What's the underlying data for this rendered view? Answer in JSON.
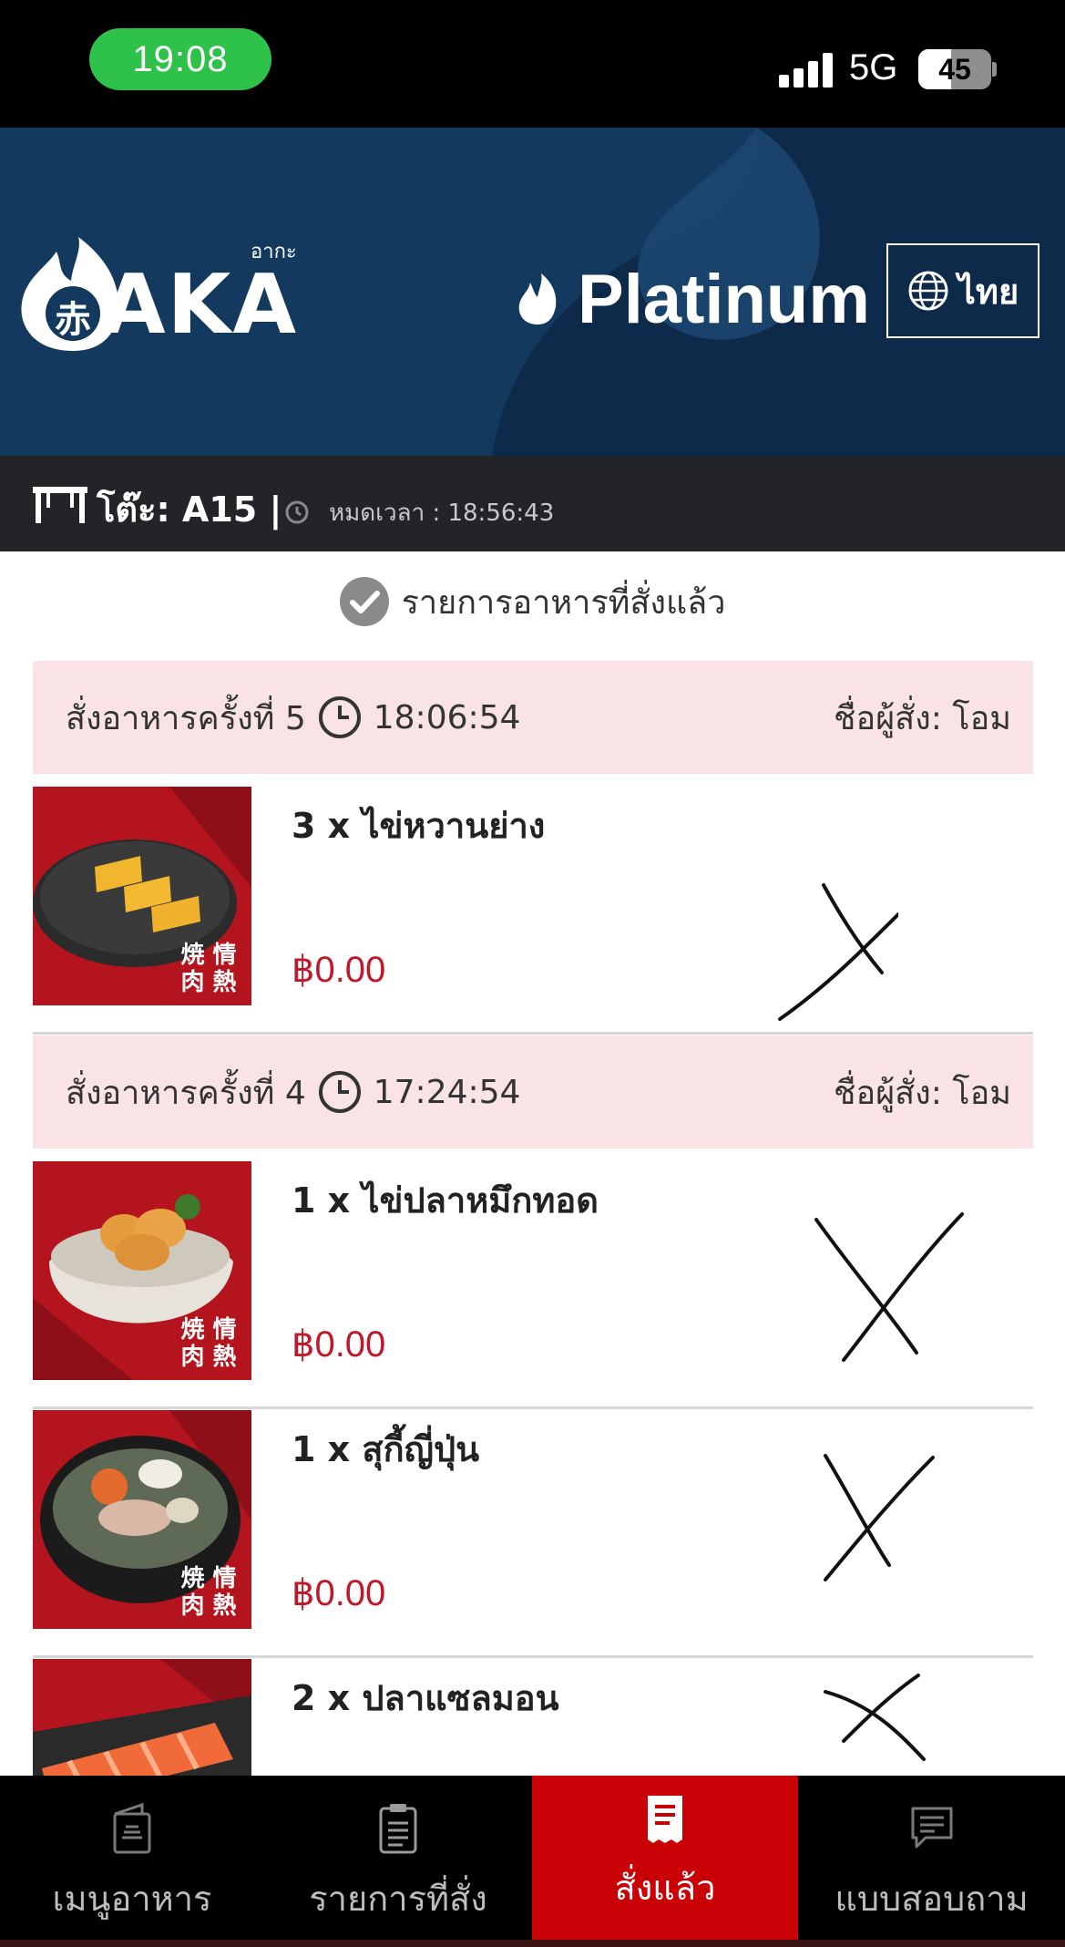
{
  "status_bar": {
    "time": "19:08",
    "network": "5G",
    "battery": "45",
    "battery_level": 0.45
  },
  "header": {
    "logo_small": "อากะ",
    "logo_text": "AKA",
    "logo_kanji": "赤",
    "tier_label": "Platinum",
    "language_label": "ไทย",
    "colors": {
      "background": "#14395e",
      "accent": "#c90006"
    }
  },
  "table_bar": {
    "table_label": "โต๊ะ: A15 |",
    "expire_text": "หมดเวลา : 18:56:43"
  },
  "section_title": "รายการอาหารที่สั่งแล้ว",
  "orders": [
    {
      "round_label": "สั่งอาหารครั้งที่ 5",
      "time": "18:06:54",
      "orderer": "ชื่อผู้สั่ง: โอม",
      "items": [
        {
          "name": "3 x ไข่หวานย่าง",
          "price": "฿0.00",
          "kanji": "焼情肉熱"
        }
      ]
    },
    {
      "round_label": "สั่งอาหารครั้งที่ 4",
      "time": "17:24:54",
      "orderer": "ชื่อผู้สั่ง: โอม",
      "items": [
        {
          "name": "1 x ไข่ปลาหมึกทอด",
          "price": "฿0.00",
          "kanji": "焼情肉熱"
        },
        {
          "name": "1 x สุกี้ญี่ปุ่น",
          "price": "฿0.00",
          "kanji": "焼情肉熱"
        },
        {
          "name": "2 x ปลาแซลมอน",
          "price": "",
          "kanji": ""
        }
      ]
    }
  ],
  "bottom_nav": {
    "items": [
      {
        "label": "เมนูอาหาร",
        "icon": "menu-book-icon"
      },
      {
        "label": "รายการที่สั่ง",
        "icon": "clipboard-icon"
      },
      {
        "label": "สั่งแล้ว",
        "icon": "receipt-icon"
      },
      {
        "label": "แบบสอบถาม",
        "icon": "chat-icon"
      }
    ],
    "active_index": 2
  }
}
